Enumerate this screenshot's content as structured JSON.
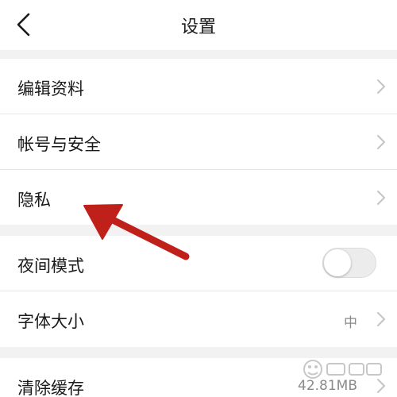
{
  "header": {
    "title": "设置",
    "back_icon": "chevron-left-icon"
  },
  "groups": [
    {
      "items": [
        {
          "label": "编辑资料",
          "accessory": "chevron-right-icon"
        },
        {
          "label": "帐号与安全",
          "accessory": "chevron-right-icon"
        },
        {
          "label": "隐私",
          "accessory": "chevron-right-icon"
        }
      ]
    },
    {
      "items": [
        {
          "label": "夜间模式",
          "accessory": "toggle",
          "toggle_on": false
        },
        {
          "label": "字体大小",
          "value": "中",
          "accessory": "chevron-right-icon"
        }
      ]
    },
    {
      "items": [
        {
          "label": "清除缓存",
          "value": "42.81MB",
          "accessory": "chevron-right-icon"
        }
      ]
    }
  ],
  "annotation": {
    "type": "arrow",
    "color": "#c0201a",
    "points_to": "隐私"
  },
  "colors": {
    "background": "#f2f2f2",
    "surface": "#ffffff",
    "text": "#1a1a1a",
    "secondary_text": "#8a8a8a",
    "chevron": "#c4c4c4",
    "annotation": "#c0201a"
  }
}
